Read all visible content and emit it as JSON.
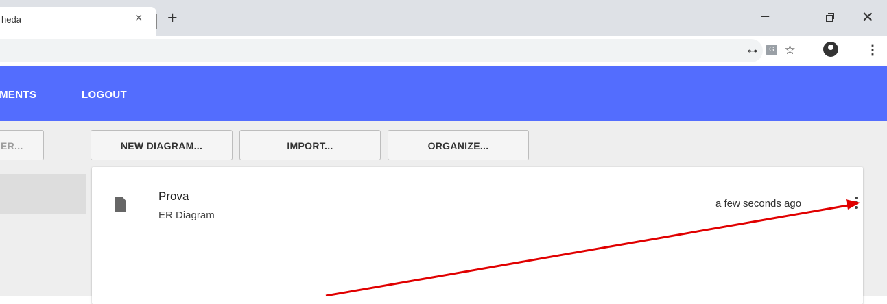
{
  "browser": {
    "tab_title": "heda",
    "tab_close": "×",
    "new_tab": "+",
    "minimize": "–",
    "close": "✕",
    "key_glyph": "⊶",
    "translate_glyph": "G",
    "star_glyph": "☆",
    "menu_glyph": "⋮"
  },
  "nav": {
    "documents": "UMENTS",
    "logout": "LOGOUT"
  },
  "actions": {
    "filter": "ER...",
    "new_diagram": "NEW DIAGRAM...",
    "import": "IMPORT...",
    "organize": "ORGANIZE..."
  },
  "document": {
    "name": "Prova",
    "type": "ER Diagram",
    "modified": "a few seconds ago"
  },
  "colors": {
    "appbar": "#536dfe",
    "annotation_arrow": "#e00000"
  }
}
